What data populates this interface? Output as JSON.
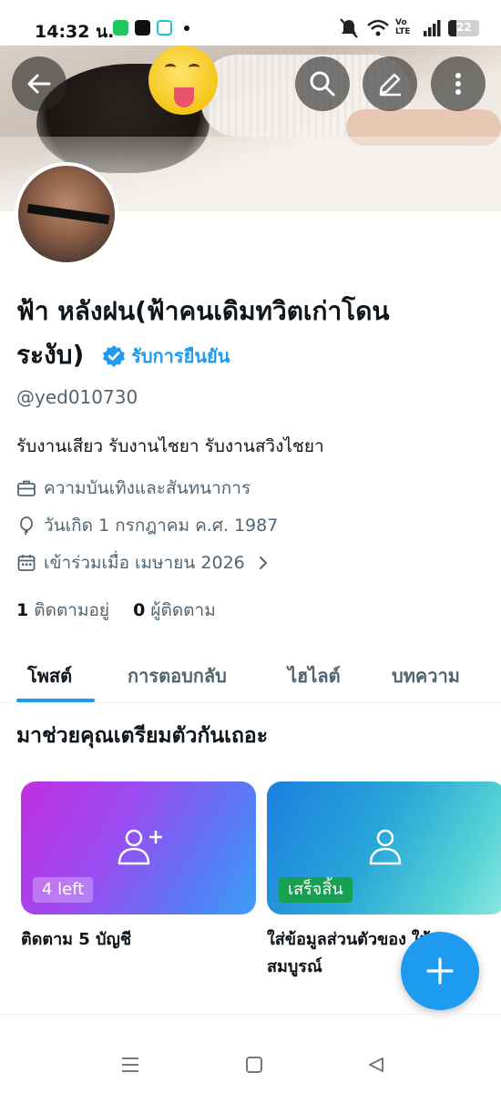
{
  "status_bar": {
    "time": "14:32 น.",
    "battery": "22",
    "network_label": "Vo LTE"
  },
  "header": {
    "back_icon": "arrow-left-icon",
    "search_icon": "search-icon",
    "edit_icon": "pencil-icon",
    "more_icon": "more-vertical-icon"
  },
  "profile": {
    "name_line1": "ฟ้า หลังฝน(ฟ้าคนเดิมทวิตเก่าโดน",
    "name_line2": "ระงับ)",
    "verified_label": "รับการยืนยัน",
    "handle": "@yed010730",
    "bio": "รับงานเสียว รับงานไชยา รับงานสวิงไชยา",
    "category": "ความบันเทิงและสันทนาการ",
    "birthday": "วันเกิด 1 กรกฎาคม ค.ศ. 1987",
    "joined": "เข้าร่วมเมื่อ เมษายน 2026",
    "following_count": "1",
    "following_label": "ติดตามอยู่",
    "followers_count": "0",
    "followers_label": "ผู้ติดตาม"
  },
  "tabs": [
    {
      "label": "โพสต์",
      "active": true
    },
    {
      "label": "การตอบกลับ",
      "active": false
    },
    {
      "label": "ไฮไลต์",
      "active": false
    },
    {
      "label": "บทความ",
      "active": false
    }
  ],
  "onboarding": {
    "title": "มาช่วยคุณเตรียมตัวกันเถอะ",
    "cards": [
      {
        "badge": "4 left",
        "caption": "ติดตาม 5 บัญชี",
        "icon": "add-user-icon"
      },
      {
        "badge": "เสร็จสิ้น",
        "caption_line1": "ใส่ข้อมูลส่วนตัวของ",
        "caption_line1_tail": "ให้",
        "caption_line2": "สมบูรณ์",
        "icon": "user-icon"
      }
    ]
  },
  "fab": {
    "icon": "plus-icon"
  },
  "nav": {
    "menu_icon": "recent-apps-icon",
    "home_icon": "home-square-icon",
    "back_icon": "back-triangle-icon"
  },
  "colors": {
    "accent": "#1d9bf0",
    "text": "#0f1419",
    "muted": "#536471",
    "success": "#17a052"
  }
}
